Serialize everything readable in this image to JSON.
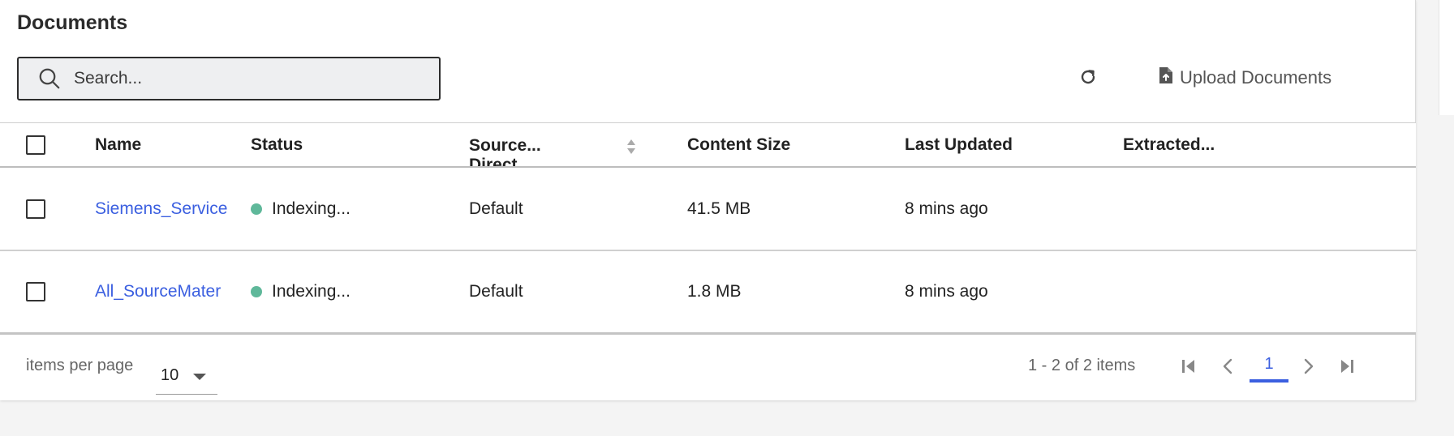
{
  "title": "Documents",
  "search": {
    "placeholder": "Search..."
  },
  "toolbar": {
    "upload_label": "Upload Documents"
  },
  "table": {
    "columns": {
      "name": "Name",
      "status": "Status",
      "source_line1": "Source...",
      "source_line2": "Direct...",
      "content_size": "Content Size",
      "last_updated": "Last Updated",
      "extracted": "Extracted..."
    },
    "rows": [
      {
        "name": "Siemens_Service",
        "status": "Indexing...",
        "source": "Default",
        "size": "41.5 MB",
        "updated": "8 mins ago",
        "extracted": ""
      },
      {
        "name": "All_SourceMater",
        "status": "Indexing...",
        "source": "Default",
        "size": "1.8 MB",
        "updated": "8 mins ago",
        "extracted": ""
      }
    ]
  },
  "pager": {
    "items_per_page_label": "items per page",
    "items_per_page_value": "10",
    "range_text": "1 - 2 of 2 items",
    "current_page": "1"
  },
  "colors": {
    "link": "#3b5fe0",
    "status_dot": "#5fb89a",
    "accent": "#3b5fe0"
  },
  "icons": [
    "search-icon",
    "refresh-icon",
    "upload-file-icon",
    "sort-icon",
    "first-page-icon",
    "prev-page-icon",
    "next-page-icon",
    "last-page-icon",
    "chevron-down-icon"
  ]
}
